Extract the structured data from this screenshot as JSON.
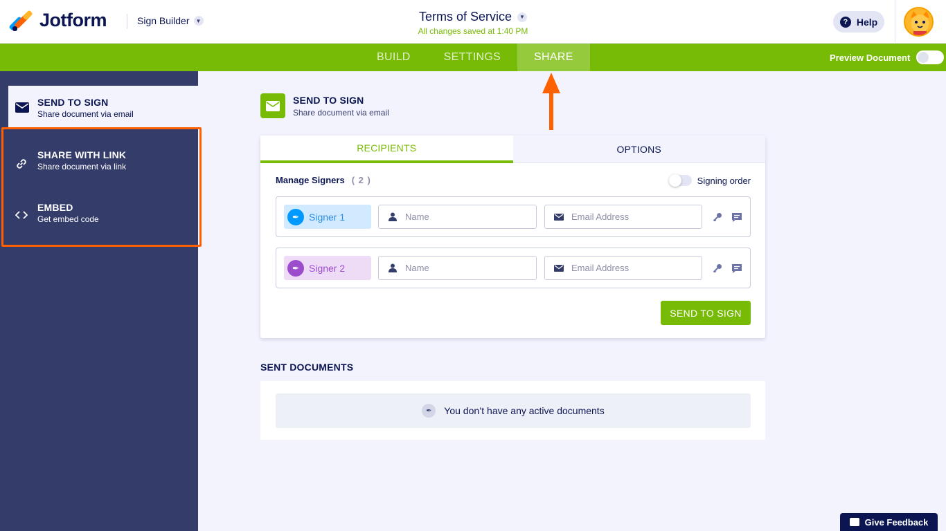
{
  "header": {
    "brand": "Jotform",
    "builder_label": "Sign Builder",
    "document_title": "Terms of Service",
    "save_status": "All changes saved at 1:40 PM",
    "help_label": "Help"
  },
  "nav": {
    "tabs": [
      {
        "label": "BUILD"
      },
      {
        "label": "SETTINGS"
      },
      {
        "label": "SHARE",
        "active": true
      }
    ],
    "preview_label": "Preview Document"
  },
  "sidebar": {
    "items": [
      {
        "title": "SEND TO SIGN",
        "subtitle": "Share document via email",
        "icon": "envelope-icon",
        "active": true
      },
      {
        "title": "SHARE WITH LINK",
        "subtitle": "Share document via link",
        "icon": "link-icon"
      },
      {
        "title": "EMBED",
        "subtitle": "Get embed code",
        "icon": "code-icon"
      }
    ]
  },
  "main": {
    "section_title": "SEND TO SIGN",
    "section_subtitle": "Share document via email",
    "tabs": [
      {
        "label": "RECIPIENTS",
        "active": true
      },
      {
        "label": "OPTIONS"
      }
    ],
    "manage_label": "Manage Signers",
    "signer_count": "( 2 )",
    "signing_order_label": "Signing order",
    "signers": [
      {
        "label": "Signer 1",
        "name_placeholder": "Name",
        "email_placeholder": "Email Address",
        "color": "#0099ff"
      },
      {
        "label": "Signer 2",
        "name_placeholder": "Name",
        "email_placeholder": "Email Address",
        "color": "#9c4dcc"
      }
    ],
    "send_button": "SEND TO SIGN",
    "sent_title": "SENT DOCUMENTS",
    "empty_message": "You don’t have any active documents"
  },
  "feedback_label": "Give Feedback",
  "colors": {
    "accent_green": "#78bb07",
    "navy": "#0a1551",
    "sidebar": "#343c6a",
    "highlight_orange": "#ff6100"
  }
}
